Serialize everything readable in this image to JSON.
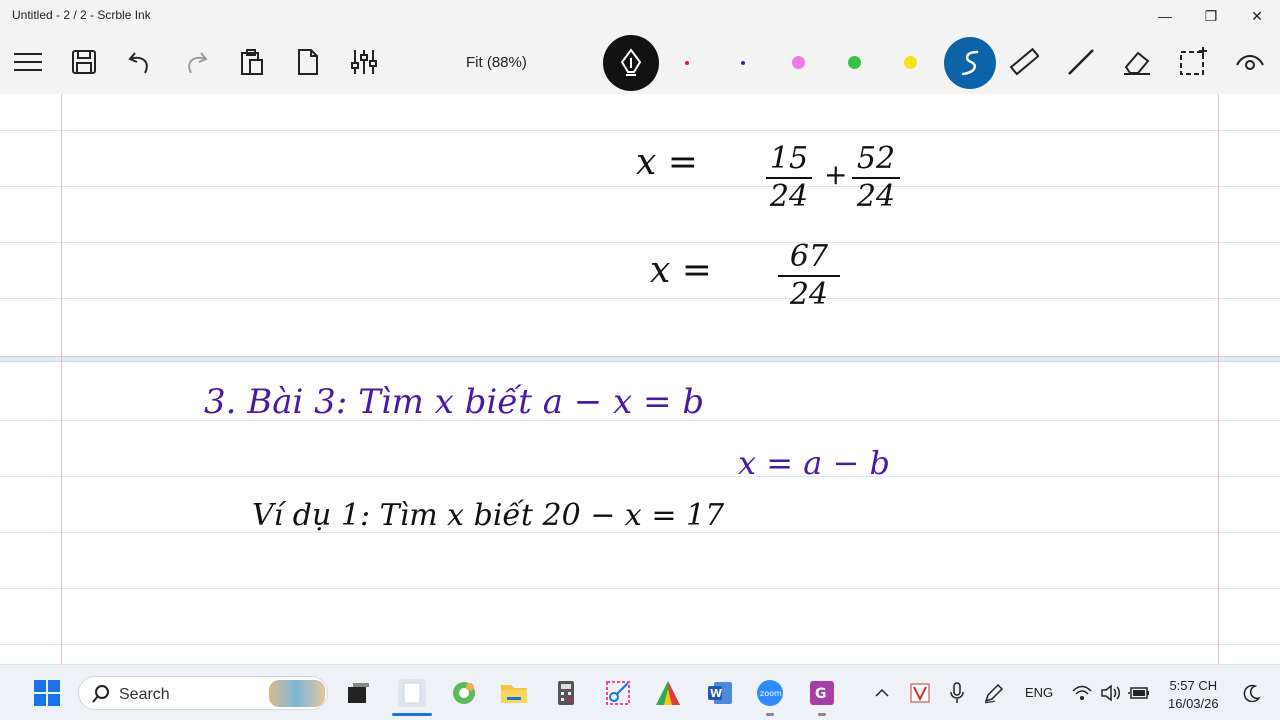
{
  "window": {
    "title": "Untitled - 2 / 2 - Scrble Ink",
    "minimize": "—",
    "maximize": "❐",
    "close": "✕"
  },
  "toolbar": {
    "zoom_label": "Fit (88%)",
    "pen_colors": [
      "#d81b3c",
      "#2b2ba8",
      "#f07ae8",
      "#37c24a",
      "#f5e21a"
    ],
    "active_tool_color": "#0d63a8",
    "pen_active_color": "#111111"
  },
  "notebook": {
    "page_top": {
      "line1_lhs": "x  =",
      "frac1_num": "15",
      "frac1_den": "24",
      "plus": "+",
      "frac2_num": "52",
      "frac2_den": "24",
      "line2_lhs": "x  =",
      "frac3_num": "67",
      "frac3_den": "24"
    },
    "page_bottom": {
      "heading": "3. Bài 3:  Tìm x biết   a − x = b",
      "rule": "x = a − b",
      "example": "Ví dụ 1:  Tìm x biết    20 − x  = 17"
    },
    "ink_colors": {
      "black": "#111111",
      "purple": "#4b1aa3"
    }
  },
  "taskbar": {
    "search_placeholder": "Search",
    "language": "ENG",
    "time": "5:57 CH",
    "date": "16/03/26"
  }
}
